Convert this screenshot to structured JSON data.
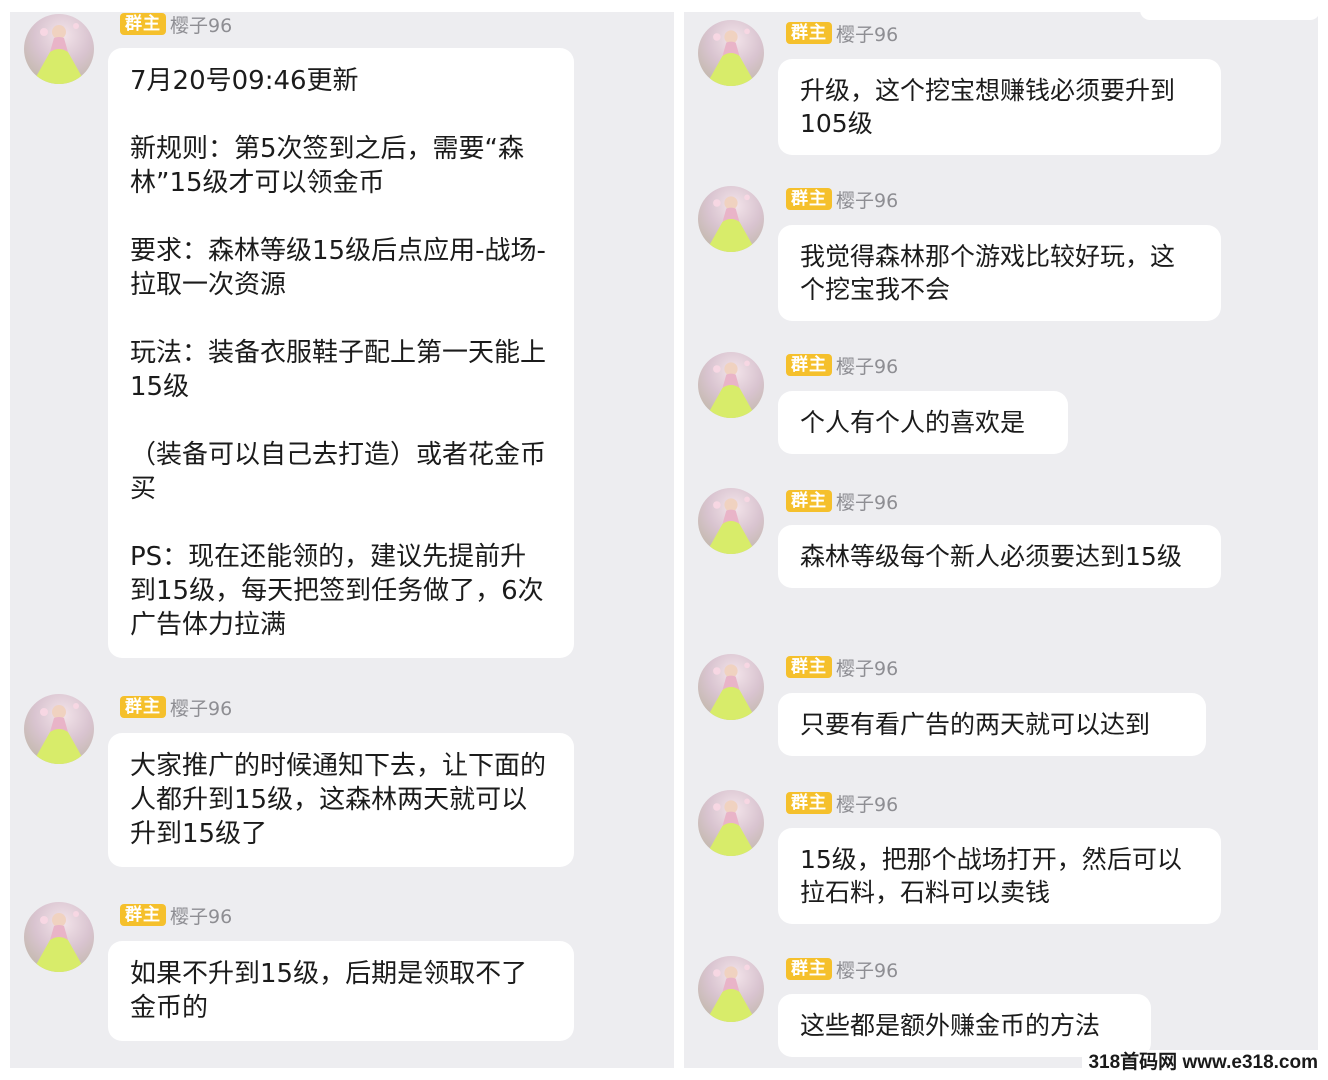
{
  "left_chat": {
    "messages": [
      {
        "badge": "群主",
        "sender": "樱子96",
        "paragraphs": [
          "7月20号09:46更新",
          "新规则：第5次签到之后，需要“森林”15级才可以领金币",
          "要求：森林等级15级后点应用-战场-拉取一次资源",
          "玩法：装备衣服鞋子配上第一天能上15级",
          "（装备可以自己去打造）或者花金币买",
          "PS：现在还能领的，建议先提前升到15级，每天把签到任务做了，6次广告体力拉满"
        ]
      },
      {
        "badge": "群主",
        "sender": "樱子96",
        "paragraphs": [
          "大家推广的时候通知下去，让下面的人都升到15级，这森林两天就可以升到15级了"
        ]
      },
      {
        "badge": "群主",
        "sender": "樱子96",
        "paragraphs": [
          "如果不升到15级，后期是领取不了金币的"
        ]
      }
    ]
  },
  "right_chat": {
    "messages": [
      {
        "badge": "群主",
        "sender": "樱子96",
        "text": "升级，这个挖宝想赚钱必须要升到105级"
      },
      {
        "badge": "群主",
        "sender": "樱子96",
        "text": "我觉得森林那个游戏比较好玩，这个挖宝我不会"
      },
      {
        "badge": "群主",
        "sender": "樱子96",
        "text": "个人有个人的喜欢是"
      },
      {
        "badge": "群主",
        "sender": "樱子96",
        "text": "森林等级每个新人必须要达到15级"
      },
      {
        "badge": "群主",
        "sender": "樱子96",
        "text": "只要有看广告的两天就可以达到"
      },
      {
        "badge": "群主",
        "sender": "樱子96",
        "text": "15级，把那个战场打开，然后可以拉石料，石料可以卖钱"
      },
      {
        "badge": "群主",
        "sender": "樱子96",
        "text": "这些都是额外赚金币的方法"
      }
    ]
  },
  "watermark": "318首码网 www.e318.com",
  "colors": {
    "chat_background": "#ededf0",
    "bubble": "#ffffff",
    "badge": "#f5c02c",
    "sender_name": "#8e8e93"
  },
  "icons": {
    "avatar": "avatar-girl-in-yellow-dress"
  }
}
